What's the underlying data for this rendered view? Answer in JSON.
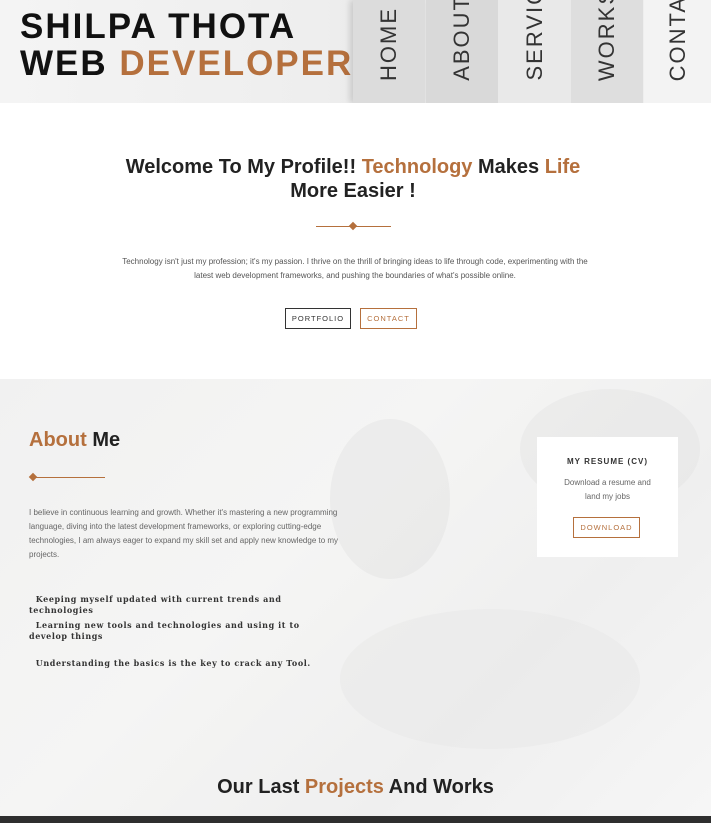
{
  "header": {
    "brand_line1": "SHILPA THOTA",
    "brand_line2_prefix": "WEB",
    "brand_line2_accent": "DEVELOPER",
    "nav": [
      {
        "label": "HOME"
      },
      {
        "label": "ABOUT"
      },
      {
        "label": "SERVIC"
      },
      {
        "label": "WORKS"
      },
      {
        "label": "CONTA"
      }
    ]
  },
  "hero": {
    "title_part1": "Welcome To My Profile!! ",
    "title_accent1": "Technology",
    "title_part2": " Makes ",
    "title_accent2": "Life",
    "title_part3": " More Easier !",
    "description": "Technology isn't just my profession; it's my passion. I thrive on the thrill of bringing ideas to life through code, experimenting with the latest web development frameworks, and pushing the boundaries of what's possible online.",
    "buttons": {
      "portfolio": "PORTFOLIO",
      "contact": "CONTACT"
    }
  },
  "about": {
    "title_accent": "About",
    "title_rest": " Me",
    "description": "I believe in continuous learning and growth. Whether it's mastering a new programming language, diving into the latest development frameworks, or exploring cutting-edge technologies, I am always eager to expand my skill set and apply new knowledge to my projects.",
    "skills": [
      "Keeping myself updated with current trends and technologies",
      "Learning new tools and technologies and using it to develop things",
      "Understanding the basics is the key to crack any Tool."
    ]
  },
  "resume": {
    "title": "MY RESUME (CV)",
    "text": "Download a resume and land my jobs",
    "button": "DOWNLOAD"
  },
  "projects": {
    "title_prefix": "Our Last ",
    "title_accent": "Projects",
    "title_suffix": " And Works"
  },
  "colors": {
    "accent": "#b5703d",
    "text_dark": "#222222",
    "text_muted": "#666666"
  }
}
